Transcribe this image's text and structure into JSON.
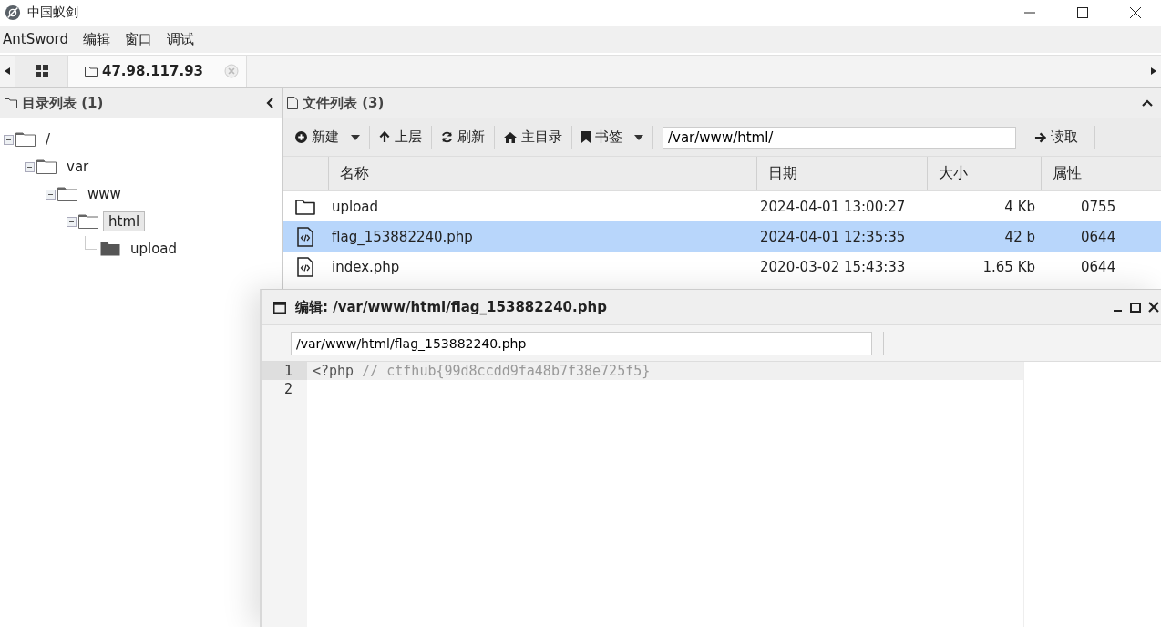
{
  "window": {
    "title": "中国蚁剑"
  },
  "menu": [
    "AntSword",
    "编辑",
    "窗口",
    "调试"
  ],
  "tabs": [
    {
      "kind": "home",
      "selected": false
    },
    {
      "kind": "site",
      "label": "47.98.117.93",
      "selected": true
    }
  ],
  "directory_panel": {
    "title": "目录列表 (1)",
    "tree": [
      {
        "label": "/",
        "expanded": true,
        "selected": false,
        "children": [
          {
            "label": "var",
            "expanded": true,
            "selected": false,
            "children": [
              {
                "label": "www",
                "expanded": true,
                "selected": false,
                "children": [
                  {
                    "label": "html",
                    "expanded": true,
                    "selected": true,
                    "children": [
                      {
                        "label": "upload",
                        "expanded": false,
                        "selected": false
                      }
                    ]
                  }
                ]
              }
            ]
          }
        ]
      }
    ]
  },
  "file_panel": {
    "title": "文件列表 (3)",
    "toolbar": [
      {
        "kind": "new",
        "label": "新建",
        "dropdown": true
      },
      {
        "kind": "up",
        "label": "上层",
        "dropdown": false
      },
      {
        "kind": "refresh",
        "label": "刷新",
        "dropdown": false
      },
      {
        "kind": "home",
        "label": "主目录",
        "dropdown": false
      },
      {
        "kind": "bookmark",
        "label": "书签",
        "dropdown": true
      }
    ],
    "path": "/var/www/html/",
    "read_button": "读取",
    "columns": [
      "名称",
      "日期",
      "大小",
      "属性"
    ],
    "rows": [
      {
        "kind": "folder",
        "name": "upload",
        "date": "2024-04-01 13:00:27",
        "size": "4 Kb",
        "mode": "0755",
        "selected": false
      },
      {
        "kind": "code",
        "name": "flag_153882240.php",
        "date": "2024-04-01 12:35:35",
        "size": "42 b",
        "mode": "0644",
        "selected": true
      },
      {
        "kind": "code",
        "name": "index.php",
        "date": "2020-03-02 15:43:33",
        "size": "1.65 Kb",
        "mode": "0644",
        "selected": false
      }
    ]
  },
  "editor": {
    "title": "编辑: /var/www/html/flag_153882240.php",
    "path": "/var/www/html/flag_153882240.php",
    "lines": [
      {
        "number": "1",
        "active": true,
        "tokens": [
          {
            "kind": "keyword",
            "text": "<?php"
          },
          {
            "kind": "comment",
            "text": "// ctfhub{99d8ccdd9fa48b7f38e725f5}"
          }
        ]
      },
      {
        "number": "2",
        "active": false
      }
    ]
  }
}
